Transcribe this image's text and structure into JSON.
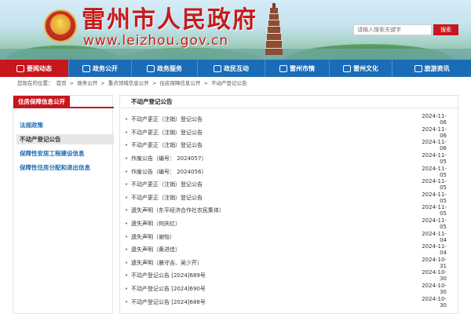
{
  "header": {
    "site_title": "雷州市人民政府",
    "site_domain": "www.leizhou.gov.cn",
    "search_placeholder": "请输入搜索关键字",
    "search_label": "搜索"
  },
  "nav": {
    "items": [
      {
        "label": "要闻动态",
        "active": true
      },
      {
        "label": "政务公开"
      },
      {
        "label": "政务服务"
      },
      {
        "label": "政民互动"
      },
      {
        "label": "雷州市情"
      },
      {
        "label": "雷州文化"
      },
      {
        "label": "旅游资讯"
      }
    ]
  },
  "breadcrumb": {
    "prefix": "您现在的位置：",
    "items": [
      "首页",
      "政务公开",
      "重点领域信息公开",
      "住房保障信息公开",
      "不动产登记公告"
    ],
    "separator": ">"
  },
  "sidebar": {
    "title": "住房保障信息公开",
    "items": [
      {
        "label": "法规政策"
      },
      {
        "label": "不动产登记公告",
        "active": true
      },
      {
        "label": "保障性安居工程建设信息"
      },
      {
        "label": "保障性住房分配和退出信息"
      }
    ]
  },
  "main": {
    "title": "不动产登记公告",
    "rows": [
      {
        "title": "不动产更正（注销）登记公告",
        "date": "2024-11-06"
      },
      {
        "title": "不动产更正（注销）登记公告",
        "date": "2024-11-06"
      },
      {
        "title": "不动产更正（注销）登记公告",
        "date": "2024-11-06"
      },
      {
        "title": "作废公告（编号： 2024057）",
        "date": "2024-11-05"
      },
      {
        "title": "作废公告（编号： 2024056）",
        "date": "2024-11-05"
      },
      {
        "title": "不动产更正（注销）登记公告",
        "date": "2024-11-05"
      },
      {
        "title": "不动产更正（注销）登记公告",
        "date": "2024-11-05"
      },
      {
        "title": "遗失声明（东平经济合作社农民集体）",
        "date": "2024-11-05"
      },
      {
        "title": "遗失声明（何庆红）",
        "date": "2024-11-05"
      },
      {
        "title": "遗失声明（谢怡）",
        "date": "2024-11-04"
      },
      {
        "title": "遗失声明（黄进佳）",
        "date": "2024-11-04"
      },
      {
        "title": "遗失声明（晨守吉、吴少芹）",
        "date": "2024-10-31"
      },
      {
        "title": "不动产登记公告 [2024]689号",
        "date": "2024-10-30"
      },
      {
        "title": "不动产登记公告 [2024]690号",
        "date": "2024-10-30"
      },
      {
        "title": "不动产登记公告 [2024]688号",
        "date": "2024-10-30"
      }
    ]
  },
  "colors": {
    "brand_red": "#c8161d",
    "nav_blue": "#1b6cb6",
    "link_blue": "#1b6cb6"
  },
  "icons": {
    "list_bullet": "•"
  }
}
